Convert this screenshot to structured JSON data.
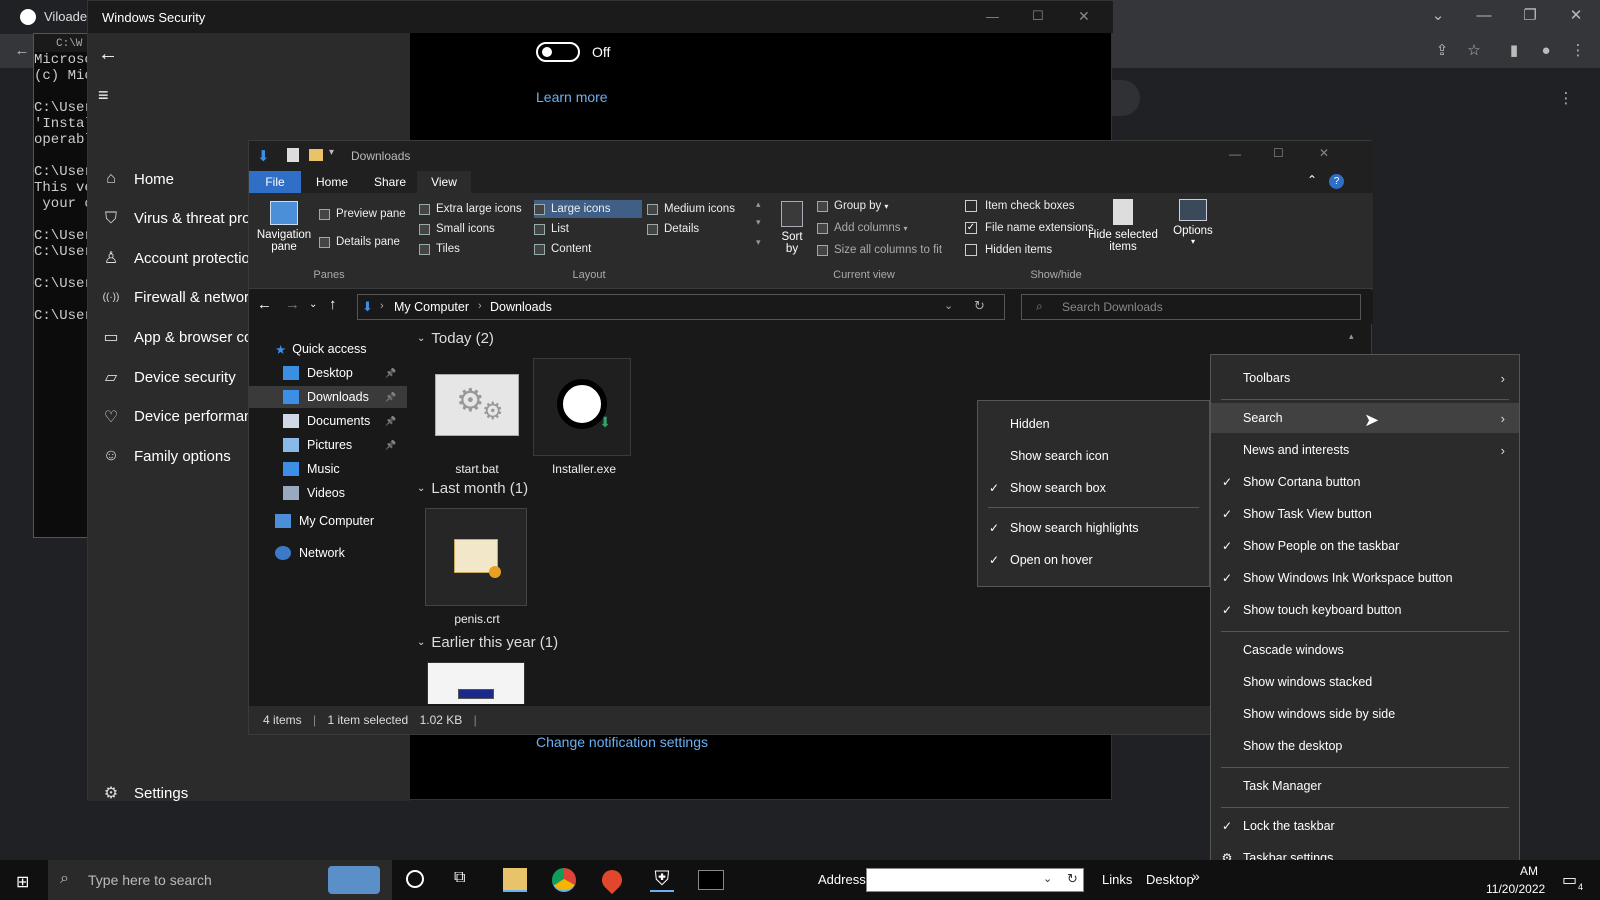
{
  "chrome": {
    "tab_title": "Viloader"
  },
  "cmd": {
    "title": "C:\\W",
    "lines": [
      "Microsc",
      "(c) Mic",
      "",
      "C:\\User",
      "'Instal",
      "operabl",
      "",
      "C:\\User",
      "This ve",
      " your c",
      "",
      "C:\\User",
      "C:\\User",
      "",
      "C:\\User",
      "",
      "C:\\User"
    ]
  },
  "security": {
    "title": "Windows Security",
    "nav": [
      "Home",
      "Virus & threat pro",
      "Account protectio",
      "Firewall & networ",
      "App & browser co",
      "Device security",
      "Device performanc",
      "Family options"
    ],
    "settings": "Settings",
    "toggle_state": "Off",
    "learn_more": "Learn more",
    "notification_link": "Change notification settings"
  },
  "explorer": {
    "title": "Downloads",
    "tabs": [
      "File",
      "Home",
      "Share",
      "View"
    ],
    "ribbon": {
      "navigation_pane": "Navigation",
      "navigation_pane_2": "pane",
      "preview_pane": "Preview pane",
      "details_pane": "Details pane",
      "panes_group": "Panes",
      "layout_items": [
        "Extra large icons",
        "Large icons",
        "Medium icons",
        "Small icons",
        "List",
        "Details",
        "Tiles",
        "Content"
      ],
      "layout_group": "Layout",
      "sort_by": "Sort",
      "sort_by_2": "by",
      "group_by": "Group by",
      "add_columns": "Add columns",
      "size_all": "Size all columns to fit",
      "current_view_group": "Current view",
      "item_check_boxes": "Item check boxes",
      "file_name_extensions": "File name extensions",
      "hidden_items": "Hidden items",
      "hide_selected": "Hide selected",
      "hide_selected_2": "items",
      "options": "Options",
      "showhide_group": "Show/hide"
    },
    "breadcrumb": [
      "My Computer",
      "Downloads"
    ],
    "search_placeholder": "Search Downloads",
    "nav": {
      "quick_access": "Quick access",
      "items": [
        "Desktop",
        "Downloads",
        "Documents",
        "Pictures",
        "Music",
        "Videos"
      ],
      "my_computer": "My Computer",
      "network": "Network"
    },
    "groups": {
      "today": "Today (2)",
      "last_month": "Last month (1)",
      "earlier": "Earlier this year (1)"
    },
    "files": {
      "start_bat": "start.bat",
      "installer": "Installer.exe",
      "crt": "penis.crt"
    },
    "status": {
      "items": "4 items",
      "selected": "1 item selected",
      "size": "1.02 KB"
    }
  },
  "search_submenu": {
    "items": [
      {
        "label": "Hidden",
        "checked": false
      },
      {
        "label": "Show search icon",
        "checked": false
      },
      {
        "label": "Show search box",
        "checked": true
      },
      {
        "label": "Show search highlights",
        "checked": true
      },
      {
        "label": "Open on hover",
        "checked": true
      }
    ]
  },
  "taskbar_menu": {
    "items": [
      {
        "label": "Toolbars",
        "checked": false,
        "submenu": true
      },
      {
        "label": "Search",
        "checked": false,
        "submenu": true
      },
      {
        "label": "News and interests",
        "checked": false,
        "submenu": true
      },
      {
        "label": "Show Cortana button",
        "checked": true
      },
      {
        "label": "Show Task View button",
        "checked": true
      },
      {
        "label": "Show People on the taskbar",
        "checked": true
      },
      {
        "label": "Show Windows Ink Workspace button",
        "checked": true
      },
      {
        "label": "Show touch keyboard button",
        "checked": true
      },
      {
        "label": "Cascade windows",
        "checked": false
      },
      {
        "label": "Show windows stacked",
        "checked": false
      },
      {
        "label": "Show windows side by side",
        "checked": false
      },
      {
        "label": "Show the desktop",
        "checked": false
      },
      {
        "label": "Task Manager",
        "checked": false
      },
      {
        "label": "Lock the taskbar",
        "checked": true
      },
      {
        "label": "Taskbar settings",
        "checked": false
      }
    ]
  },
  "taskbar": {
    "search_placeholder": "Type here to search",
    "address_label": "Address",
    "links": "Links",
    "desktop": "Desktop",
    "chevron": "»",
    "clock_ampm": "AM",
    "date": "11/20/2022",
    "notif_count": "4"
  }
}
